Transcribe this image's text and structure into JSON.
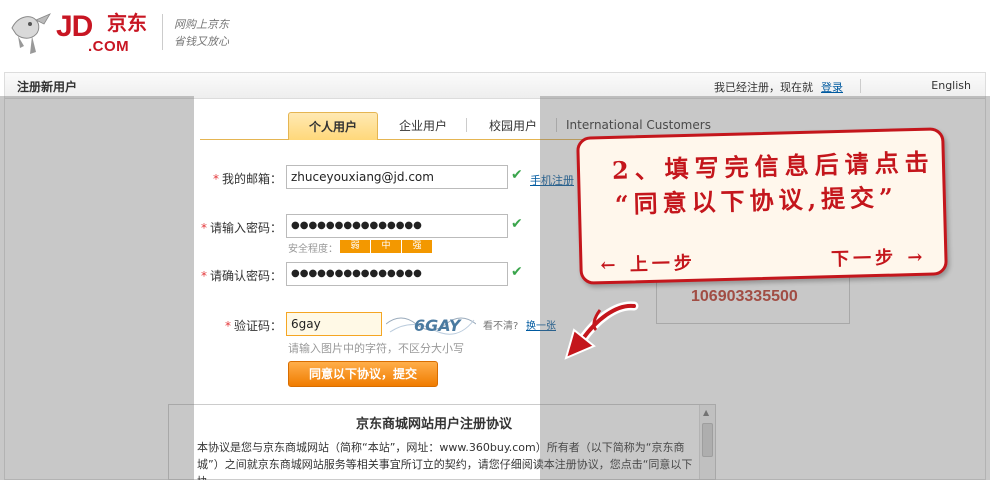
{
  "header": {
    "logo_text": "JD",
    "logo_cn": "京东",
    "logo_com": ".COM",
    "slogan_line1": "网购上京东",
    "slogan_line2": "省钱又放心"
  },
  "panel": {
    "title": "注册新用户",
    "login_hint": "我已经注册，现在就",
    "login_link": "登录",
    "english": "English"
  },
  "tabs": {
    "personal": "个人用户",
    "enterprise": "企业用户",
    "campus": "校园用户",
    "international": "International Customers"
  },
  "form": {
    "email_label": "我的邮箱：",
    "email_value": "zhuceyouxiang@jd.com",
    "phone_register": "手机注册",
    "password_label": "请输入密码：",
    "password_value": "●●●●●●●●●●●●●●●",
    "strength_label": "安全程度：",
    "strength_weak": "弱",
    "strength_mid": "中",
    "strength_strong": "强",
    "confirm_label": "请确认密码：",
    "confirm_value": "●●●●●●●●●●●●●●●",
    "captcha_label": "验证码：",
    "captcha_value": "6gay",
    "captcha_image_text": "6GAY",
    "captcha_hint": "看不清?",
    "captcha_change": "换一张",
    "captcha_note": "请输入图片中的字符，不区分大小写",
    "submit_label": "同意以下协议，提交"
  },
  "agreement": {
    "title": "京东商城网站用户注册协议",
    "body": "本协议是您与京东商城网站（简称“本站”，网址：www.360buy.com）所有者（以下简称为“京东商城”）之间就京东商城网站服务等相关事宜所订立的契约，请您仔细阅读本注册协议，您点击“同意以下协"
  },
  "phone_number": "106903335500",
  "callout": {
    "line1": "2、填写完信息后请点击",
    "line2": "“同意以下协议,提交”",
    "prev": "← 上一步",
    "next": "下一步 →"
  },
  "colors": {
    "brand_red": "#c81623",
    "accent_orange": "#f07c00",
    "link_blue": "#005aa0"
  }
}
